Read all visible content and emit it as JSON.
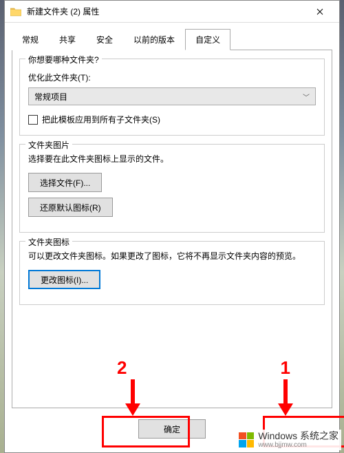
{
  "titlebar": {
    "icon": "folder-icon",
    "title": "新建文件夹 (2) 属性"
  },
  "tabs": [
    "常规",
    "共享",
    "安全",
    "以前的版本",
    "自定义"
  ],
  "active_tab": "自定义",
  "group_kind": {
    "title": "你想要哪种文件夹?",
    "optimize_label": "优化此文件夹(T):",
    "dropdown_value": "常规项目",
    "checkbox_label": "把此模板应用到所有子文件夹(S)"
  },
  "group_picture": {
    "title": "文件夹图片",
    "desc": "选择要在此文件夹图标上显示的文件。",
    "choose_btn": "选择文件(F)...",
    "restore_btn": "还原默认图标(R)"
  },
  "group_icon": {
    "title": "文件夹图标",
    "desc": "可以更改文件夹图标。如果更改了图标，它将不再显示文件夹内容的预览。",
    "change_btn": "更改图标(I)..."
  },
  "bottom": {
    "ok": "确定"
  },
  "annotations": {
    "label1": "1",
    "label2": "2"
  },
  "watermark": {
    "main": "Windows 系统之家",
    "sub": "www.bjjmw.com"
  }
}
